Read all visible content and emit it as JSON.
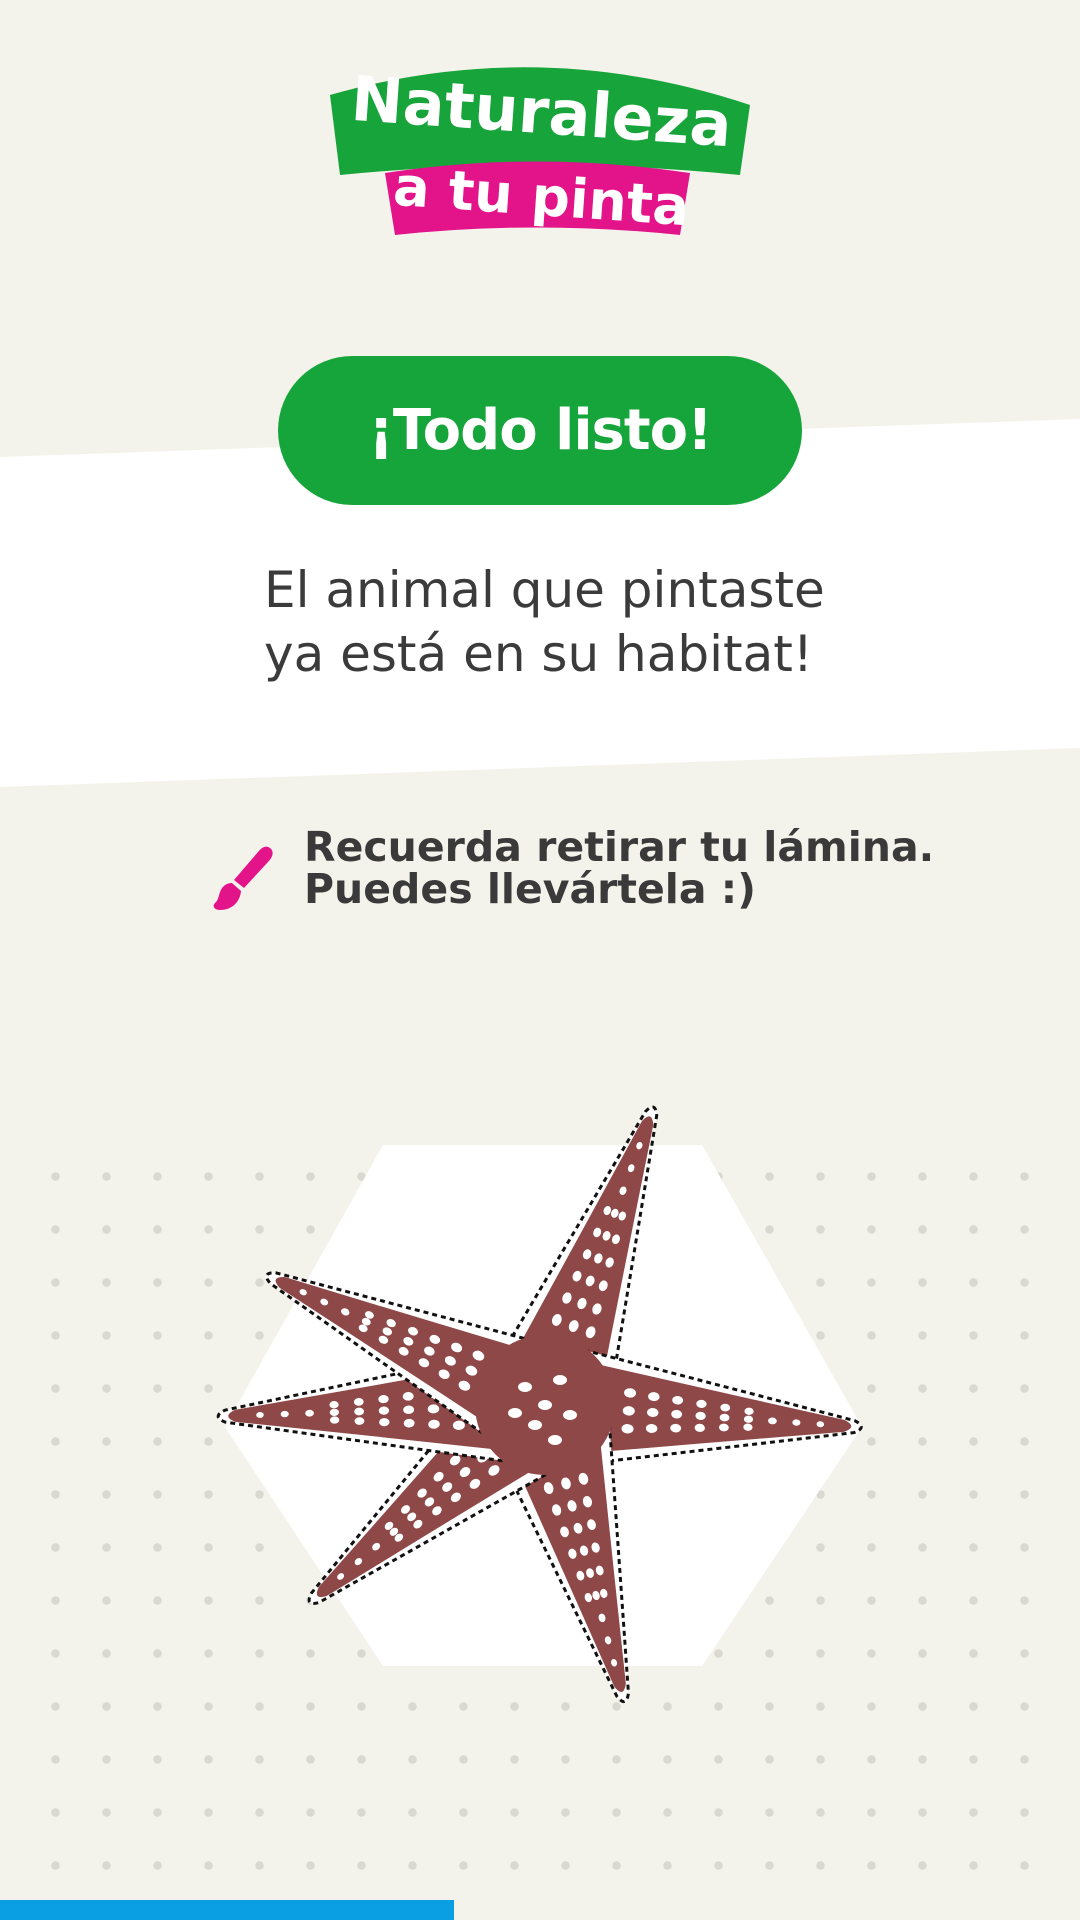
{
  "logo": {
    "line1": "Naturaleza",
    "line2": "a tu pinta"
  },
  "status": {
    "button_label": "¡Todo listo!",
    "message_line1": "El animal que pintaste",
    "message_line2": "ya está en su habitat!"
  },
  "tip": {
    "icon": "paintbrush-icon",
    "line1": "Recuerda retirar tu lámina.",
    "line2": "Puedes llevártela :)"
  },
  "artwork": {
    "animal": "starfish",
    "body_color": "#8e4848"
  },
  "colors": {
    "background": "#f4f3eb",
    "band": "#ffffff",
    "accent_green": "#16a53a",
    "accent_pink": "#e3138a",
    "progress_blue": "#0a9fe3"
  },
  "progress": {
    "fraction": 0.42
  }
}
